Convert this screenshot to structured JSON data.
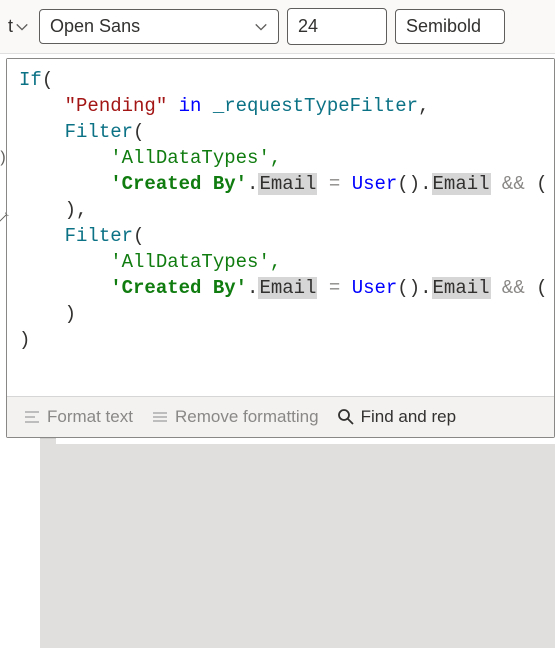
{
  "toolbar": {
    "left_fragment": "t",
    "font": "Open Sans",
    "size": "24",
    "weight": "Semibold"
  },
  "code": {
    "l1_if": "If",
    "l1_p": "(",
    "l2_str": "\"Pending\"",
    "l2_in": " in ",
    "l2_var": "_requestTypeFilter",
    "l2_c": ",",
    "l3_fn": "Filter",
    "l3_p": "(",
    "l4_s": "'AllDataTypes'",
    "l4_c": ",",
    "l5_cb": "'Created By'",
    "l5_d1": ".",
    "l5_em1": "Email",
    "l5_eq": " = ",
    "l5_user": "User",
    "l5_up": "()",
    "l5_d2": ".",
    "l5_em2": "Email",
    "l5_amp": " && ",
    "l5_tp": "(",
    "l6_cp": "),",
    "l7_fn": "Filter",
    "l7_p": "(",
    "l8_s": "'AllDataTypes'",
    "l8_c": ",",
    "l9_cb": "'Created By'",
    "l9_d1": ".",
    "l9_em1": "Email",
    "l9_eq": " = ",
    "l9_user": "User",
    "l9_up": "()",
    "l9_d2": ".",
    "l9_em2": "Email",
    "l9_amp": " && ",
    "l9_tp": "(",
    "l10_cp": ")",
    "l11_cp": ")"
  },
  "footer": {
    "format": "Format text",
    "remove": "Remove formatting",
    "find": "Find and rep"
  }
}
